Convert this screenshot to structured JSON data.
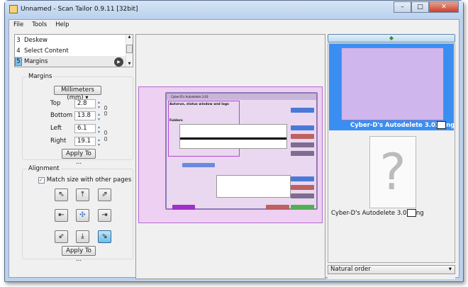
{
  "window": {
    "title": "Unnamed - Scan Tailor 0.9.11 [32bit]",
    "min": "–",
    "max": "□",
    "close": "✕"
  },
  "menu": [
    "File",
    "Tools",
    "Help"
  ],
  "stages": [
    {
      "n": "3",
      "label": "Deskew"
    },
    {
      "n": "4",
      "label": "Select Content"
    },
    {
      "n": "5",
      "label": "Margins"
    }
  ],
  "margins": {
    "group": "Margins",
    "units": "Millimeters (mm)",
    "top_label": "Top",
    "top": "2.8",
    "bottom_label": "Bottom",
    "bottom": "13.8",
    "left_label": "Left",
    "left": "6.1",
    "right_label": "Right",
    "right": "19.1",
    "apply": "Apply To ..."
  },
  "alignment": {
    "group": "Alignment",
    "match": "Match size with other pages",
    "apply": "Apply To ...",
    "selected": "bottom-right"
  },
  "preview": {
    "app_title": "Cyber-D's Autodelete 3.03",
    "section1": "Autorun, status window and logs",
    "section2": "Folders"
  },
  "thumbnails": [
    {
      "name": "Cyber-D's Autodelete 3.03.png",
      "selected": true
    },
    {
      "name": "Cyber-D's Autodelete 3.03.png",
      "selected": false
    }
  ],
  "sort": {
    "value": "Natural order"
  }
}
